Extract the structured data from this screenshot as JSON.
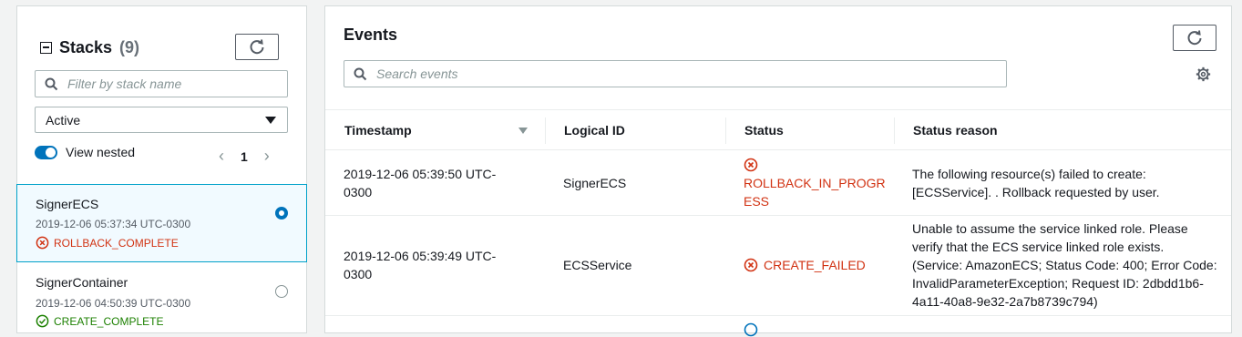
{
  "stacks": {
    "title": "Stacks",
    "count": "(9)",
    "filter_placeholder": "Filter by stack name",
    "filter_value": "Active",
    "view_nested_label": "View nested",
    "page": "1",
    "items": [
      {
        "name": "SignerECS",
        "time": "2019-12-06 05:37:34 UTC-0300",
        "status": "ROLLBACK_COMPLETE"
      },
      {
        "name": "SignerContainer",
        "time": "2019-12-06 04:50:39 UTC-0300",
        "status": "CREATE_COMPLETE"
      }
    ]
  },
  "events": {
    "title": "Events",
    "search_placeholder": "Search events",
    "columns": [
      "Timestamp",
      "Logical ID",
      "Status",
      "Status reason"
    ],
    "rows": [
      {
        "timestamp_l1": "2019-12-06 05:39:50 UTC-",
        "timestamp_l2": "0300",
        "logical_id": "SignerECS",
        "status_l1": "ROLLBACK_IN_PROGR",
        "status_l2": "ESS",
        "reason_lines": [
          "The following resource(s) failed to create:",
          "[ECSService]. . Rollback requested by user."
        ]
      },
      {
        "timestamp_l1": "2019-12-06 05:39:49 UTC-",
        "timestamp_l2": "0300",
        "logical_id": "ECSService",
        "status": "CREATE_FAILED",
        "reason_lines": [
          "Unable to assume the service linked role. Please",
          "verify that the ECS service linked role exists.",
          "(Service: AmazonECS; Status Code: 400; Error Code:",
          "InvalidParameterException; Request ID: 2dbdd1b6-",
          "4a11-40a8-9e32-2a7b8739c794)"
        ]
      }
    ]
  },
  "colors": {
    "error": "#d13212",
    "success": "#1d8102",
    "accent": "#0073bb",
    "info": "#0073bb"
  }
}
